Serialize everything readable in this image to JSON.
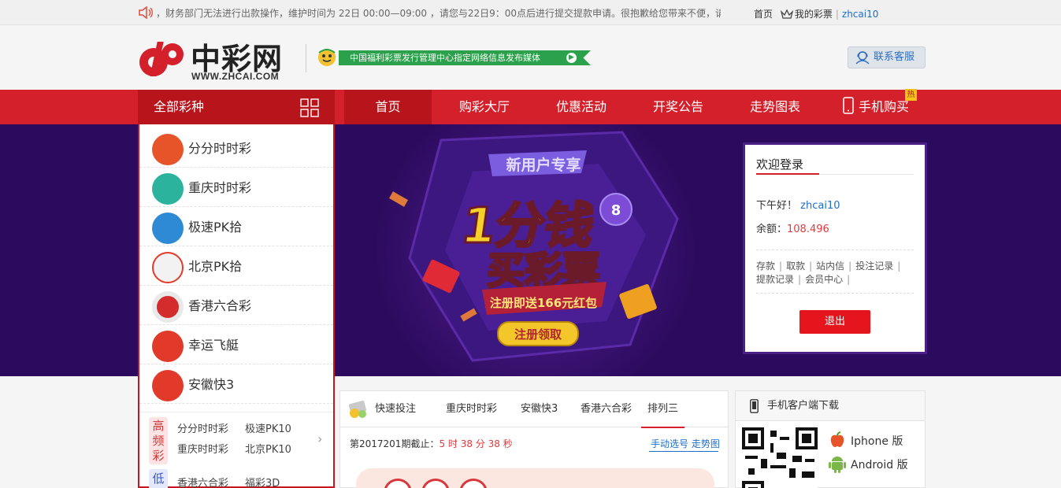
{
  "notice": {
    "text": "，财务部门无法进行出款操作，维护时间为 22日 00:00—09:00 ，请您与22日9：00点后进行提交提款申请。很抱歉给您带来不便，请"
  },
  "top_links": {
    "home": "首页",
    "my_lottery": "我的彩票",
    "username": "zhcai10"
  },
  "header": {
    "logo_name": "中彩网",
    "logo_url": "WWW.ZHCAI.COM",
    "slogan": "中国福利彩票发行管理中心指定网络信息发布媒体",
    "service": "联系客服"
  },
  "nav": {
    "all_categories": "全部彩种",
    "items": [
      "首页",
      "购彩大厅",
      "优惠活动",
      "开奖公告",
      "走势图表",
      "手机购买"
    ],
    "hot_badge": "热"
  },
  "sidebar": {
    "lotteries": [
      {
        "name": "分分时时彩",
        "color": "#e8542a"
      },
      {
        "name": "重庆时时彩",
        "color": "#2bb39e"
      },
      {
        "name": "极速PK拾",
        "color": "#2f8ad6"
      },
      {
        "name": "北京PK拾",
        "color": "#f2f2f2"
      },
      {
        "name": "香港六合彩",
        "color": "#d42c2c"
      },
      {
        "name": "幸运飞艇",
        "color": "#e23a2a"
      },
      {
        "name": "安徽快3",
        "color": "#e23a2a"
      }
    ],
    "high_freq_tag": "高频彩",
    "high_freq_items": [
      "分分时时彩",
      "极速PK10",
      "重庆时时彩",
      "北京PK10"
    ],
    "low_freq_tag": "低",
    "low_freq_items": [
      "香港六合彩",
      "福彩3D"
    ]
  },
  "banner": {
    "ribbon": "新用户专享",
    "headline_1": "1分钱",
    "headline_2": "买彩票",
    "subline": "注册即送166元红包",
    "cta": "注册领取",
    "ball_number": "8"
  },
  "login": {
    "title": "欢迎登录",
    "greeting": "下午好！",
    "username": "zhcai10",
    "balance_label": "余额：",
    "balance": "108.496",
    "links": [
      "存款",
      "取款",
      "站内信",
      "投注记录",
      "提款记录",
      "会员中心"
    ],
    "logout": "退出"
  },
  "bet": {
    "tabs": [
      "快速投注",
      "重庆时时彩",
      "安徽快3",
      "香港六合彩",
      "排列三"
    ],
    "active_tab": "排列三",
    "issue_prefix": "第2017201期截止：",
    "countdown": "5 时 38 分 38 秒",
    "manual": "手动选号",
    "trend": "走势图"
  },
  "app": {
    "title": "手机客户端下载",
    "iphone": "Iphone 版",
    "android": "Android 版"
  },
  "colors": {
    "brand_red": "#d4202a",
    "banner_bg": "#2c0b5e",
    "link_blue": "#1e6ec8"
  }
}
